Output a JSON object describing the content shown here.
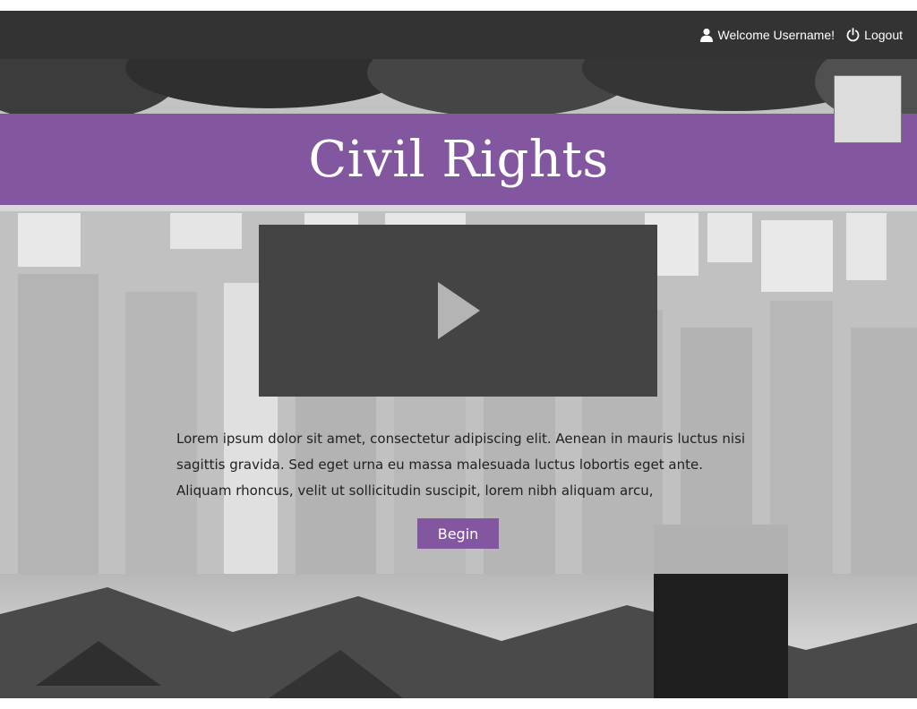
{
  "header": {
    "welcome_text": "Welcome Username!",
    "user_icon": "user-icon",
    "logout_label": "Logout",
    "logout_icon": "power-icon"
  },
  "banner": {
    "title": "Civil Rights",
    "color": "#8356a0"
  },
  "video": {
    "play_icon": "play-icon"
  },
  "main": {
    "description": "Lorem ipsum dolor sit amet, consectetur adipiscing elit. Aenean in mauris luctus nisi sagittis gravida. Sed eget urna eu massa malesuada luctus lobortis eget ante. Aliquam rhoncus, velit ut sollicitudin suscipit, lorem nibh aliquam arcu,",
    "begin_label": "Begin"
  },
  "colors": {
    "topbar": "#333333",
    "accent": "#8356a0"
  }
}
